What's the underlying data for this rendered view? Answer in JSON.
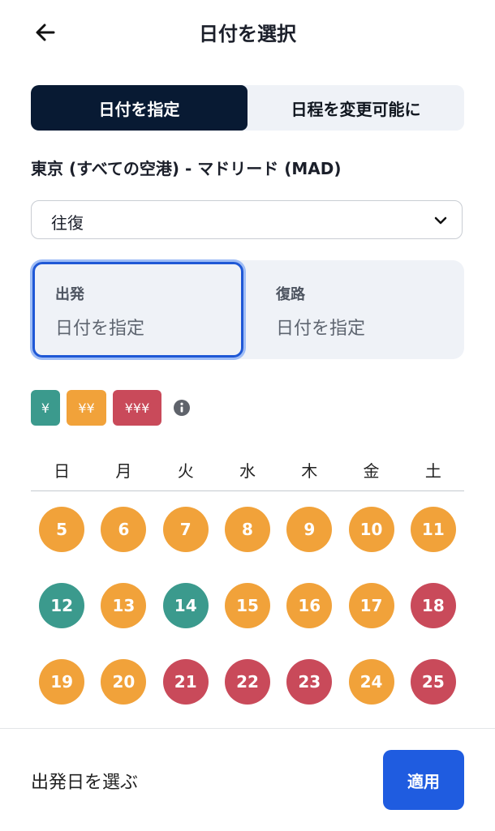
{
  "header": {
    "title": "日付を選択",
    "back_icon": "arrow-left-icon"
  },
  "mode_tabs": [
    {
      "label": "日付を指定",
      "active": true
    },
    {
      "label": "日程を変更可能に",
      "active": false
    }
  ],
  "route": "東京 (すべての空港) - マドリード (MAD)",
  "trip_type": {
    "selected": "往復",
    "icon": "chevron-down-icon"
  },
  "departure": {
    "label": "出発",
    "placeholder": "日付を指定"
  },
  "return": {
    "label": "復路",
    "placeholder": "日付を指定"
  },
  "price_legend": [
    {
      "label": "¥",
      "level": "low"
    },
    {
      "label": "¥¥",
      "level": "mid"
    },
    {
      "label": "¥¥¥",
      "level": "high"
    }
  ],
  "weekdays": [
    "日",
    "月",
    "火",
    "水",
    "木",
    "金",
    "土"
  ],
  "calendar": {
    "colors": {
      "low": "#3b9a8d",
      "mid": "#f1a23a",
      "high": "#c94a5a"
    },
    "weeks": [
      [
        {
          "day": "5",
          "level": "mid"
        },
        {
          "day": "6",
          "level": "mid"
        },
        {
          "day": "7",
          "level": "mid"
        },
        {
          "day": "8",
          "level": "mid"
        },
        {
          "day": "9",
          "level": "mid"
        },
        {
          "day": "10",
          "level": "mid"
        },
        {
          "day": "11",
          "level": "mid"
        }
      ],
      [
        {
          "day": "12",
          "level": "low"
        },
        {
          "day": "13",
          "level": "mid"
        },
        {
          "day": "14",
          "level": "low"
        },
        {
          "day": "15",
          "level": "mid"
        },
        {
          "day": "16",
          "level": "mid"
        },
        {
          "day": "17",
          "level": "mid"
        },
        {
          "day": "18",
          "level": "high"
        }
      ],
      [
        {
          "day": "19",
          "level": "mid"
        },
        {
          "day": "20",
          "level": "mid"
        },
        {
          "day": "21",
          "level": "high"
        },
        {
          "day": "22",
          "level": "high"
        },
        {
          "day": "23",
          "level": "high"
        },
        {
          "day": "24",
          "level": "mid"
        },
        {
          "day": "25",
          "level": "high"
        }
      ]
    ]
  },
  "footer": {
    "prompt": "出発日を選ぶ",
    "apply_label": "適用"
  }
}
